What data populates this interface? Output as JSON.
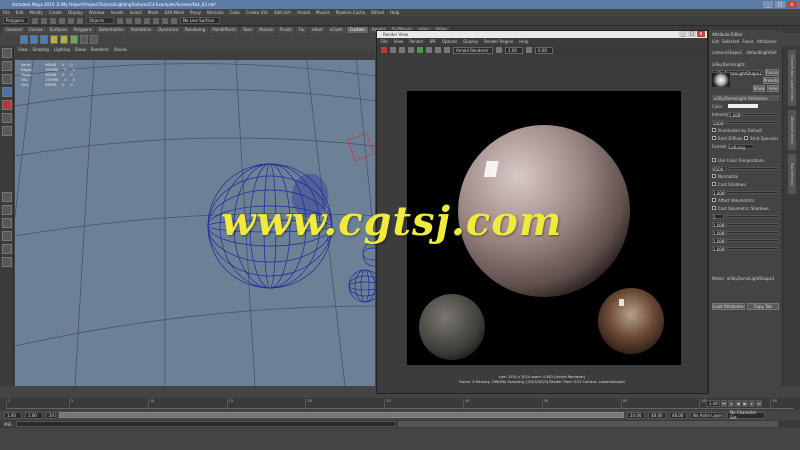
{
  "window": {
    "title": "Autodesk Maya 2015: E:/My Project/Project/Tutorial/LightingTextures/C4 Examples/Scenes/Kak_03.mb*",
    "min": "_",
    "max": "□",
    "close": "x"
  },
  "menubar": {
    "items": [
      "File",
      "Edit",
      "Modify",
      "Create",
      "Display",
      "Window",
      "Assets",
      "Select",
      "Mesh",
      "Edit Mesh",
      "Proxy",
      "Normals",
      "Color",
      "Create UVs",
      "Edit UVs",
      "Arnold",
      "Muscle",
      "Pipeline Cache",
      "Bifrost",
      "Help"
    ]
  },
  "statusline": {
    "mode": "Polygons",
    "objects_label": "Objects",
    "no_live_surface": "No Live Surface"
  },
  "shelf": {
    "tabs": [
      "General",
      "Curves",
      "Surfaces",
      "Polygons",
      "Deformation",
      "Animation",
      "Dynamics",
      "Rendering",
      "PaintEffects",
      "Toon",
      "Muscle",
      "Fluids",
      "Fur",
      "nHair",
      "nCloth",
      "Custom",
      "Arnold",
      "GoZBrush",
      "nSim",
      "XGen"
    ],
    "active_tab": "Custom"
  },
  "viewport": {
    "menu": [
      "View",
      "Shading",
      "Lighting",
      "Show",
      "Renderer",
      "Panels"
    ],
    "hud": [
      {
        "label": "Verts:",
        "value": "96498",
        "v2": "0",
        "v3": "0"
      },
      {
        "label": "Edges:",
        "value": "192996",
        "v2": "0",
        "v3": "0"
      },
      {
        "label": "Faces:",
        "value": "96498",
        "v2": "0",
        "v3": "0"
      },
      {
        "label": "Tris:",
        "value": "192996",
        "v2": "0",
        "v3": "0"
      },
      {
        "label": "UVs:",
        "value": "99999",
        "v2": "0",
        "v3": "0"
      }
    ],
    "background_color": "#6d8196",
    "wire_color": "#1b2a9c"
  },
  "render_view": {
    "title": "Render View",
    "menu": [
      "File",
      "View",
      "Render",
      "IPR",
      "Options",
      "Display",
      "Render Region",
      "Help"
    ],
    "renderer": "Arnold Renderer",
    "zoom_field": "1.00",
    "exposure_field": "0.00",
    "info_line1": "size: 1024 x 1024 zoom: 0.463     (Arnold Renderer)",
    "info_line2": "Frame: 4     Memory: 296(Mb)     Sampling: [3/3/3/3/3/3]     Render Time: 0:51     Camera: cameraShape1"
  },
  "attribute_editor": {
    "header": "Attribute Editor",
    "menu": [
      "List",
      "Selected",
      "Focus",
      "Attributes",
      "Show",
      "Help"
    ],
    "tabs": [
      "cameraShape1",
      "defaultLightSet"
    ],
    "node_label": "aiSkyDomeLight:",
    "node_value": "aiSkyDomeLightShape1",
    "focus_button": "Focus",
    "presets_button": "Presets",
    "show_button": "Show",
    "hide_button": "Hide",
    "section": "aiSkyDomeLight Attributes",
    "color_label": "Color",
    "intensity_label": "Intensity",
    "intensity_value": "1.000",
    "resolution_value": "1000",
    "illum_default": "Illuminates by Default",
    "emit_diffuse": "Emit Diffuse",
    "emit_specular": "Emit Specular",
    "format_label": "Format",
    "format_value": "LatLong",
    "use_color_temp": "Use Color Temperature",
    "temperature_value": "6500",
    "normalize_label": "Normalize",
    "cast_shadows": "Cast Shadows",
    "shadow_density": "1.000",
    "affect_volumetrics": "Affect Volumetrics",
    "cast_volumetric_shadows": "Cast Volumetric Shadows",
    "samples_value": "1",
    "diffuse_value": "1.000",
    "specular_value": "1.000",
    "sss_value": "1.000",
    "indirect_value": "1.000",
    "notes_label": "Notes:",
    "notes_value": "aiSkyDomeLightShape1",
    "load_attributes": "Load Attributes",
    "copy_tab": "Copy Tab"
  },
  "side_tabs": [
    "Channel Box / Layer Editor",
    "Attribute Editor",
    "Tool Settings"
  ],
  "timeslider": {
    "ticks": [
      "1",
      "5",
      "10",
      "15",
      "20",
      "25",
      "30",
      "35",
      "40",
      "45",
      "50"
    ],
    "current_frame": "1.00"
  },
  "rangeslider": {
    "start": "1.00",
    "inner_start": "1.00",
    "inner_end": "24",
    "end": "24.00",
    "anim_end": "48.00",
    "total_end": "48.00",
    "anim_layer": "No Anim Layer",
    "char_set": "No Character Set"
  },
  "cmdline": {
    "lang": "MEL"
  },
  "watermark": "www.cgtsj.com",
  "colors": {
    "accent": "#5b7aa6",
    "watermark": "#f0ea3c"
  }
}
